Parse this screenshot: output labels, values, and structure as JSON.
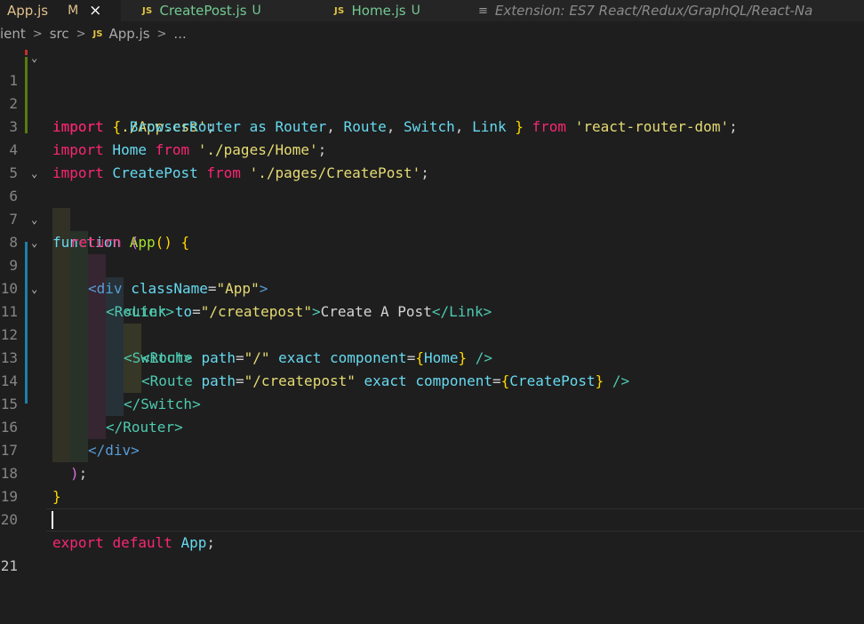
{
  "tabs": [
    {
      "name": "App.js",
      "badge": "M",
      "close": "×",
      "active": true
    },
    {
      "icon": "JS",
      "name": "CreatePost.js",
      "badge": "U"
    },
    {
      "icon": "JS",
      "name": "Home.js",
      "badge": "U"
    },
    {
      "icon": "≡",
      "name": "Extension: ES7 React/Redux/GraphQL/React-Na"
    }
  ],
  "breadcrumb": {
    "items": [
      "ient",
      "src",
      "App.js",
      "..."
    ],
    "sep": ">",
    "file_icon": "JS"
  },
  "editor": {
    "line_numbers": [
      "1",
      "2",
      "3",
      "4",
      "5",
      "6",
      "7",
      "8",
      "9",
      "10",
      "11",
      "12",
      "13",
      "14",
      "15",
      "16",
      "17",
      "18",
      "19",
      "20",
      "21"
    ],
    "current_line": "21",
    "fold_glyph": "⌄"
  },
  "code": {
    "l1": {
      "t1": "import",
      "t2": " ",
      "t3": "'./App.css'",
      "t4": ";"
    },
    "l2": {
      "t1": "import",
      "t2": " ",
      "t3": "{",
      "t4": " BrowserRouter ",
      "t5": "as",
      "t6": " Router",
      "t7": ",",
      "t8": " Route",
      "t9": ",",
      "t10": " Switch",
      "t11": ",",
      "t12": " Link ",
      "t13": "}",
      "t14": " ",
      "t15": "from",
      "t16": " ",
      "t17": "'react-router-dom'",
      "t18": ";"
    },
    "l3": {
      "t1": "import",
      "t2": " Home ",
      "t3": "from",
      "t4": " ",
      "t5": "'./pages/Home'",
      "t6": ";"
    },
    "l4": {
      "t1": "import",
      "t2": " CreatePost ",
      "t3": "from",
      "t4": " ",
      "t5": "'./pages/CreatePost'",
      "t6": ";"
    },
    "l6": {
      "t1": "function",
      "t2": " ",
      "t3": "App",
      "t4": "()",
      "t5": " ",
      "t6": "{"
    },
    "l7": {
      "t1": "return",
      "t2": " ",
      "t3": "("
    },
    "l8": {
      "t1": "<",
      "t2": "div",
      "t3": " ",
      "t4": "className",
      "t5": "=",
      "t6": "\"App\"",
      "t7": ">"
    },
    "l9": {
      "t1": "<Router>"
    },
    "l10": {
      "t1": "<",
      "t2": "Link",
      "t3": " ",
      "t4": "to",
      "t5": "=",
      "t6": "\"/createpost\"",
      "t7": ">",
      "t8": "Create A Post",
      "t9": "</",
      "t10": "Link",
      "t11": ">"
    },
    "l11": {
      "t1": "<",
      "t2": "Switch",
      "t3": ">"
    },
    "l12": {
      "t1": "<",
      "t2": "Route",
      "t3": " ",
      "t4": "path",
      "t5": "=",
      "t6": "\"/\"",
      "t7": " ",
      "t8": "exact",
      "t9": " ",
      "t10": "component",
      "t11": "=",
      "t12": "{",
      "t13": "Home",
      "t14": "}",
      "t15": " ",
      "t16": "/>"
    },
    "l13": {
      "t1": "<",
      "t2": "Route",
      "t3": " ",
      "t4": "path",
      "t5": "=",
      "t6": "\"/createpost\"",
      "t7": " ",
      "t8": "exact",
      "t9": " ",
      "t10": "component",
      "t11": "=",
      "t12": "{",
      "t13": "CreatePost",
      "t14": "}",
      "t15": " ",
      "t16": "/>"
    },
    "l14": {
      "t1": "</",
      "t2": "Switch",
      "t3": ">"
    },
    "l15": {
      "t1": "</Router>"
    },
    "l16": {
      "t1": "</",
      "t2": "div",
      "t3": ">"
    },
    "l17": {
      "t1": ")",
      "t2": ";"
    },
    "l18": {
      "t1": "}"
    },
    "l20": {
      "t1": "export",
      "t2": " ",
      "t3": "default",
      "t4": " ",
      "t5": "App",
      "t6": ";"
    }
  },
  "colors": {
    "background": "#1e1e1e",
    "tabbar": "#252526",
    "modified_gutter": "#587c0c",
    "changed_gutter": "#1b81a8"
  }
}
